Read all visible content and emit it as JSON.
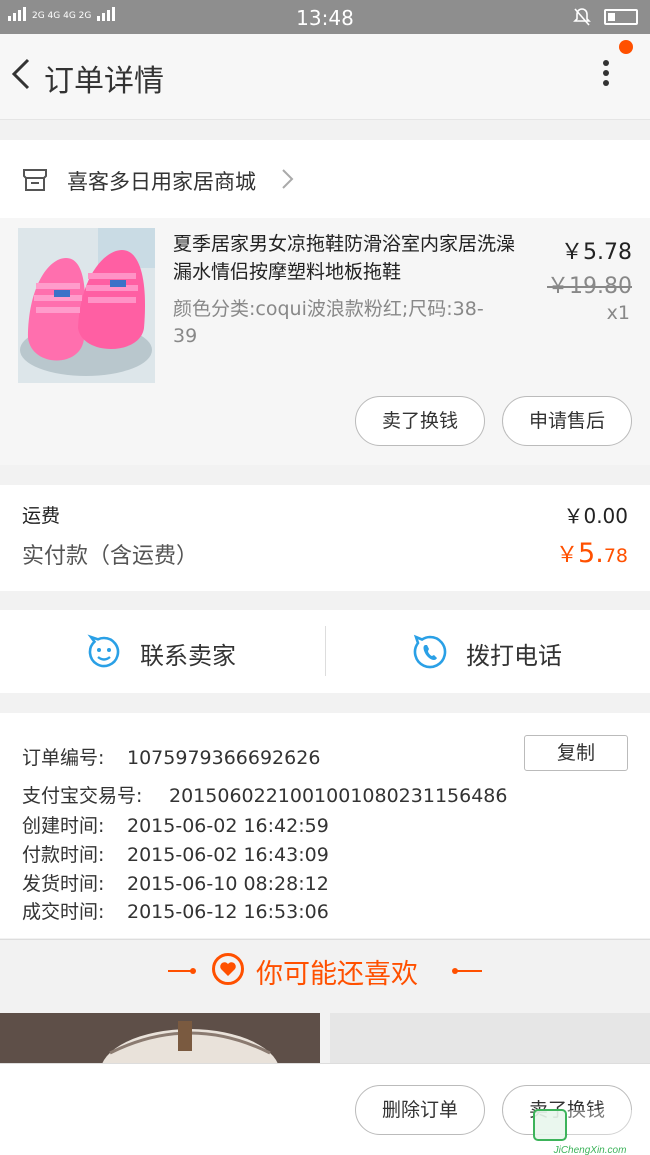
{
  "status_bar": {
    "network": "2G 4G 4G 2G",
    "time": "13:48"
  },
  "header": {
    "title": "订单详情"
  },
  "store": {
    "name": "喜客多日用家居商城"
  },
  "product": {
    "name": "夏季居家男女凉拖鞋防滑浴室内家居洗澡漏水情侣按摩塑料地板拖鞋",
    "spec": "颜色分类:coqui波浪款粉红;尺码:38-39",
    "price": "￥5.78",
    "original_price": "￥19.80",
    "quantity": "x1",
    "sell_button": "卖了换钱",
    "after_sale_button": "申请售后"
  },
  "fees": {
    "shipping_label": "运费",
    "shipping_value": "￥0.00",
    "paid_label": "实付款（含运费）",
    "paid_currency": "￥",
    "paid_int": "5.",
    "paid_dec": "78"
  },
  "contact": {
    "seller_label": "联系卖家",
    "call_label": "拨打电话"
  },
  "order_info": {
    "copy_button": "复制",
    "rows": [
      {
        "key": "订单编号:",
        "value": "1075979366692626"
      },
      {
        "key": "支付宝交易号:",
        "value": "2015060221001001080231156486"
      },
      {
        "key": "创建时间:",
        "value": "2015-06-02 16:42:59"
      },
      {
        "key": "付款时间:",
        "value": "2015-06-02 16:43:09"
      },
      {
        "key": "发货时间:",
        "value": "2015-06-10 08:28:12"
      },
      {
        "key": "成交时间:",
        "value": "2015-06-12 16:53:06"
      }
    ]
  },
  "recommend": {
    "label": "你可能还喜欢"
  },
  "bottom": {
    "delete_button": "删除订单",
    "sell_button": "卖了换钱"
  },
  "watermark": {
    "text": "JiChengXin.com"
  },
  "colors": {
    "accent": "#ff5000",
    "contact_icon": "#2aa0e6",
    "status_bar": "#8e8e8e"
  }
}
